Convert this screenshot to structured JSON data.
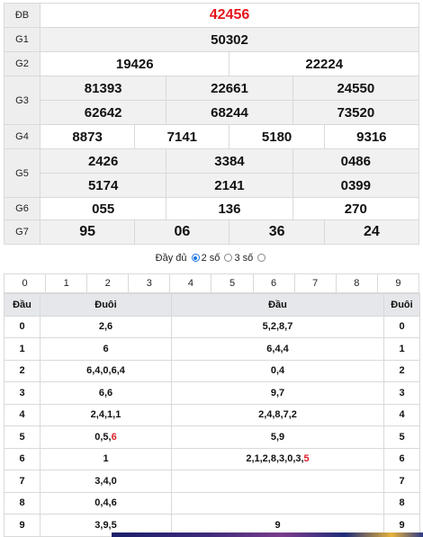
{
  "results": {
    "rows": [
      {
        "label": "ĐB",
        "values": [
          "42456"
        ]
      },
      {
        "label": "G1",
        "values": [
          "50302"
        ]
      },
      {
        "label": "G2",
        "values": [
          "19426",
          "22224"
        ]
      },
      {
        "label": "G3",
        "values": [
          "81393",
          "22661",
          "24550",
          "62642",
          "68244",
          "73520"
        ]
      },
      {
        "label": "G4",
        "values": [
          "8873",
          "7141",
          "5180",
          "9316"
        ]
      },
      {
        "label": "G5",
        "values": [
          "2426",
          "3384",
          "0486",
          "5174",
          "2141",
          "0399"
        ]
      },
      {
        "label": "G6",
        "values": [
          "055",
          "136",
          "270"
        ]
      },
      {
        "label": "G7",
        "values": [
          "95",
          "06",
          "36",
          "24"
        ]
      }
    ]
  },
  "options": {
    "full_label": "Đầy đủ",
    "two_label": "2 số",
    "three_label": "3 số",
    "selected": "2 số"
  },
  "digits": [
    "0",
    "1",
    "2",
    "3",
    "4",
    "5",
    "6",
    "7",
    "8",
    "9"
  ],
  "loto": {
    "headers": [
      "Đầu",
      "Đuôi",
      "Đầu",
      "Đuôi"
    ],
    "rows": [
      {
        "head": "0",
        "tails": "2,6",
        "heads": "5,2,8,7",
        "tail": "0"
      },
      {
        "head": "1",
        "tails": "6",
        "heads": "6,4,4",
        "tail": "1"
      },
      {
        "head": "2",
        "tails": "6,4,0,6,4",
        "heads": "0,4",
        "tail": "2"
      },
      {
        "head": "3",
        "tails": "6,6",
        "heads": "9,7",
        "tail": "3"
      },
      {
        "head": "4",
        "tails": "2,4,1,1",
        "heads": "2,4,8,7,2",
        "tail": "4"
      },
      {
        "head": "5",
        "tails_prefix": "0,5,",
        "tails_red": "6",
        "heads": "5,9",
        "tail": "5"
      },
      {
        "head": "6",
        "tails": "1",
        "heads_prefix": "2,1,2,8,3,0,3,",
        "heads_red": "5",
        "tail": "6"
      },
      {
        "head": "7",
        "tails": "3,4,0",
        "heads": "",
        "tail": "7"
      },
      {
        "head": "8",
        "tails": "0,4,6",
        "heads": "",
        "tail": "8"
      },
      {
        "head": "9",
        "tails": "3,9,5",
        "heads": "9",
        "tail": "9"
      }
    ]
  },
  "colors": {
    "special_prize": "#e4161e",
    "highlight": "#d8212a",
    "header_bg": "#e5e7ea",
    "radio_checked": "#1a73e8"
  }
}
